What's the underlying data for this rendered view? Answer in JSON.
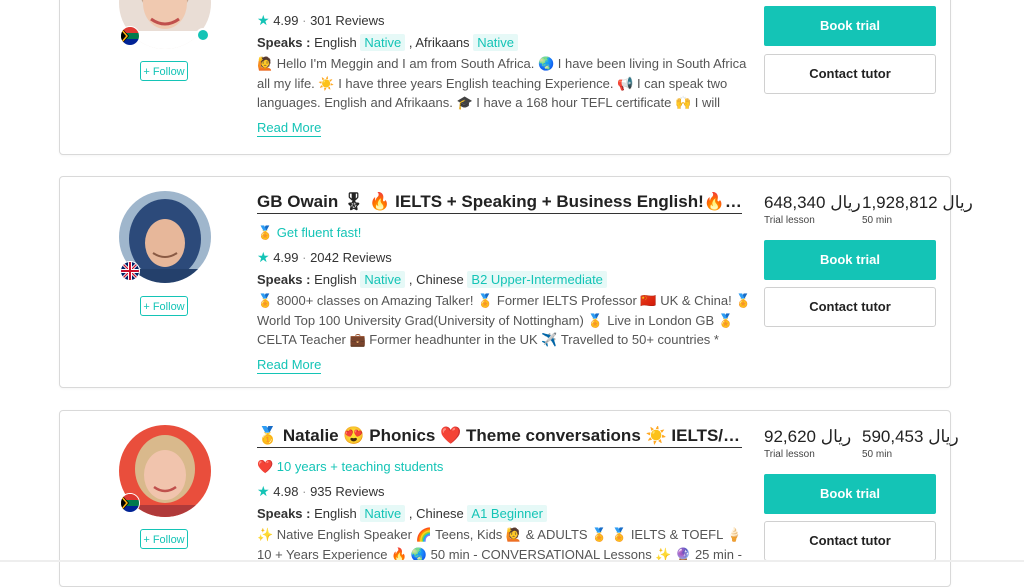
{
  "tutors": [
    {
      "name": "",
      "tagline": "",
      "rating": "4.99",
      "reviews": "301 Reviews",
      "speaks_label": "Speaks :",
      "languages": [
        {
          "lang": "English",
          "level": "Native"
        },
        {
          "lang": "Afrikaans",
          "level": "Native"
        }
      ],
      "bio": "🙋 Hello I'm Meggin and I am from South Africa. 🌏 I have been living in South Africa all my life. ☀️ I have three years English teaching Experience. 📢 I can speak two languages. English and Afrikaans. 🎓 I have a 168 hour TEFL certificate 🙌 I will hel…",
      "read_more": "Read More",
      "follow": "+ Follow",
      "flag": "south-africa-flag",
      "trial_price": "",
      "full_price": "",
      "book": "Book trial",
      "contact": "Contact tutor"
    },
    {
      "name": "GB Owain 🎖 🔥 IELTS + Speaking + Business English!🔥🔥",
      "tagline": "🏅 Get fluent fast!",
      "rating": "4.99",
      "reviews": "2042 Reviews",
      "speaks_label": "Speaks :",
      "languages": [
        {
          "lang": "English",
          "level": "Native"
        },
        {
          "lang": "Chinese",
          "level": "B2 Upper-Intermediate"
        }
      ],
      "bio": "🏅 8000+ classes on Amazing Talker! 🏅 Former IELTS Professor 🇨🇳 UK & China! 🏅 World Top 100 University Grad(University of Nottingham) 🏅 Live in London GB 🏅 CELTA Teacher 💼 Former headhunter in the UK ✈️ Travelled to 50+ countries * live…",
      "read_more": "Read More",
      "follow": "+ Follow",
      "flag": "uk-flag",
      "trial_price": "648,340 ريال",
      "trial_label": "Trial lesson",
      "full_price": "1,928,812 ريال",
      "full_label": "50 min",
      "book": "Book trial",
      "contact": "Contact tutor"
    },
    {
      "name": "🥇 Natalie 😍 Phonics ❤️ Theme conversations ☀️ IELTS/TO…",
      "tagline": "❤️ 10 years + teaching students",
      "rating": "4.98",
      "reviews": "935 Reviews",
      "speaks_label": "Speaks :",
      "languages": [
        {
          "lang": "English",
          "level": "Native"
        },
        {
          "lang": "Chinese",
          "level": "A1 Beginner"
        }
      ],
      "bio": "✨ Native English Speaker 🌈 Teens, Kids 🙋 & ADULTS 🏅 🏅 IELTS & TOEFL 🍦 10 + Years Experience 🔥 🌏 50 min - CONVERSATIONAL Lessons ✨ 🔮 25 min -",
      "read_more": "Read More",
      "follow": "+ Follow",
      "flag": "south-africa-flag",
      "trial_price": "92,620 ريال",
      "trial_label": "Trial lesson",
      "full_price": "590,453 ريال",
      "full_label": "50 min",
      "book": "Book trial",
      "contact": "Contact tutor"
    }
  ],
  "colors": {
    "accent": "#14c4b6",
    "text": "#333333",
    "border": "#d9d9d9"
  }
}
